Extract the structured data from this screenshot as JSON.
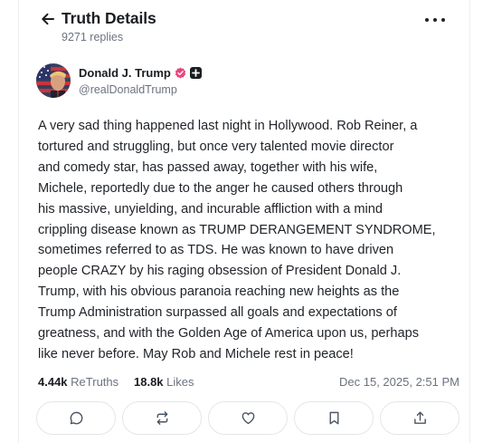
{
  "header": {
    "title": "Truth Details",
    "replies": "9271 replies",
    "icons": [
      "arrow-left-icon",
      "more-dots-icon"
    ]
  },
  "author": {
    "name": "Donald J. Trump",
    "handle": "@realDonaldTrump",
    "verified_color": "#e8457b"
  },
  "post": {
    "text": "A very sad thing happened last night in Hollywood. Rob Reiner, a\ntortured and struggling, but once very talented movie director\nand comedy star, has passed away, together with his wife,\nMichele, reportedly due to the anger he caused others through\nhis massive, unyielding, and incurable affliction with a mind\ncrippling disease known as TRUMP DERANGEMENT SYNDROME,\nsometimes referred to as TDS. He was known to have driven\npeople CRAZY by his raging obsession of President Donald J.\nTrump, with his obvious paranoia reaching new heights as the\nTrump Administration surpassed all goals and expectations of\ngreatness, and with the Golden Age of America upon us, perhaps\nlike never before. May Rob and Michele rest in peace!"
  },
  "stats": {
    "retruths_count": "4.44k",
    "retruths_label": "ReTruths",
    "likes_count": "18.8k",
    "likes_label": "Likes",
    "timestamp": "Dec 15, 2025, 2:51 PM"
  },
  "actions": [
    "reply-icon",
    "retruth-icon",
    "like-icon",
    "bookmark-icon",
    "share-icon"
  ]
}
